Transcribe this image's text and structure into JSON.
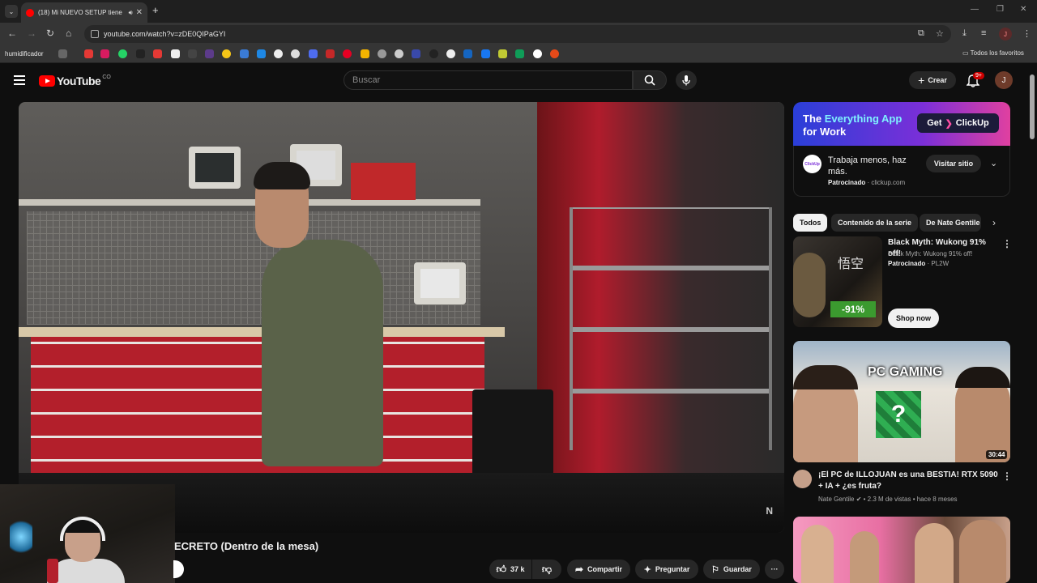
{
  "browser": {
    "tab_title": "(18) Mi NUEVO SETUP tiene",
    "url": "youtube.com/watch?v=zDE0QIPaGYI",
    "bookmark_first": "humidificador",
    "bookmark_right": "Todos los favoritos",
    "profile_initial": "J"
  },
  "header": {
    "logo": "YouTube",
    "country": "CO",
    "search_placeholder": "Buscar",
    "create_label": "Crear",
    "notif_badge": "9+",
    "avatar_initial": "J"
  },
  "video": {
    "title": "ECRETO (Dentro de la mesa)",
    "likes": "37 k",
    "share_label": "Compartir",
    "ask_label": "Preguntar",
    "save_label": "Guardar",
    "more_label": "···"
  },
  "ad": {
    "banner_line1_pre": "The ",
    "banner_line1_hl": "Everything App",
    "banner_line2": "for Work",
    "get_label": "Get",
    "brand": "ClickUp",
    "text": "Trabaja menos, haz más.",
    "sponsored": "Patrocinado",
    "domain": "· clickup.com",
    "visit_label": "Visitar sitio"
  },
  "chips": [
    "Todos",
    "Contenido de la serie",
    "De Nate Gentile"
  ],
  "recommendations": [
    {
      "title": "Black Myth: Wukong 91% off!",
      "sub1": "Black Myth: Wukong 91% off!",
      "sponsor": "Patrocinado",
      "sponsor_domain": "· PL2W",
      "thumb_text": "-91%",
      "cta": "Shop now"
    },
    {
      "title": "¡El PC de ILLOJUAN es una BESTIA! RTX 5090 + IA + ¿es fruta?",
      "channel": "Nate Gentile",
      "meta": "• 2.3 M de vistas • hace 8 meses",
      "thumb_text": "PC GAMING",
      "duration": "30:44"
    }
  ],
  "colors": {
    "yt_red": "#ff0000",
    "bg": "#0f0f0f",
    "chip_bg": "#272727"
  }
}
